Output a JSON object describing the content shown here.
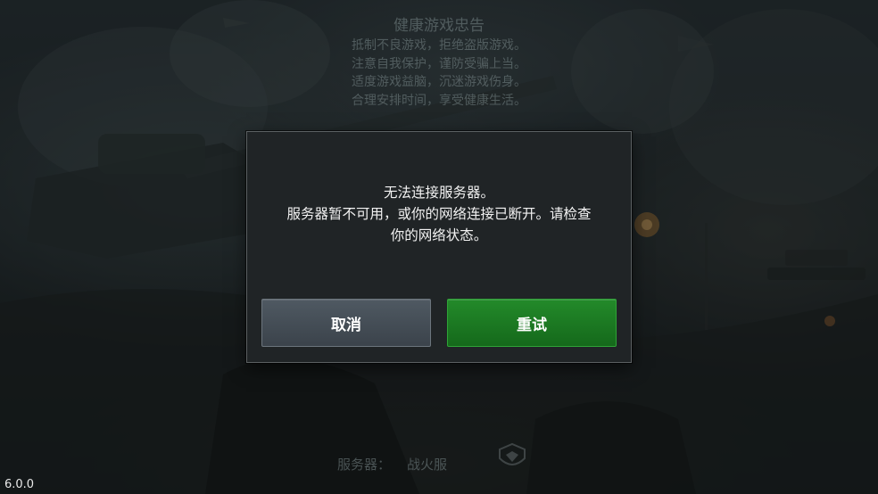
{
  "health_notice": {
    "title": "健康游戏忠告",
    "lines": [
      "抵制不良游戏，拒绝盗版游戏。",
      "注意自我保护，谨防受骗上当。",
      "适度游戏益脑，沉迷游戏伤身。",
      "合理安排时间，享受健康生活。"
    ]
  },
  "dialog": {
    "message_line1": "无法连接服务器。",
    "message_line2": "服务器暂不可用，或你的网络连接已断开。请检查",
    "message_line3": "你的网络状态。",
    "cancel_label": "取消",
    "retry_label": "重试"
  },
  "footer": {
    "server_label": "服务器：",
    "server_name": "战火服",
    "server_icon": "server-icon",
    "version": "6.0.0"
  },
  "colors": {
    "dialog_bg": "#202426",
    "retry_green": "#1d7d23",
    "cancel_gray": "#454e56"
  }
}
